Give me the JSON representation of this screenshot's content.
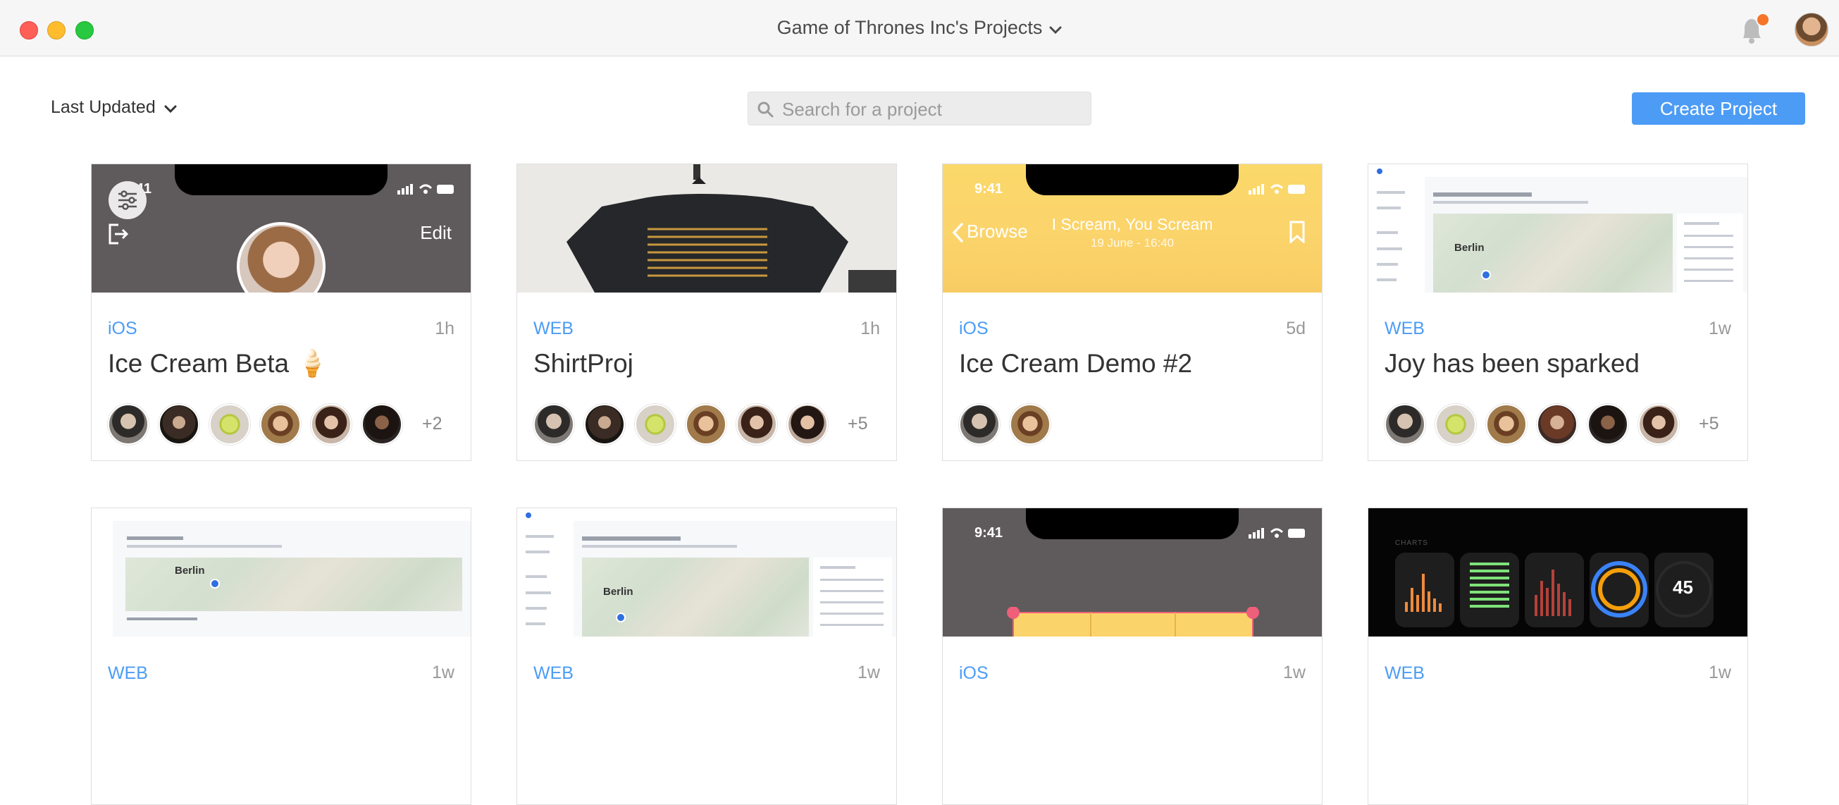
{
  "window": {
    "title": "Game of Thrones Inc's Projects"
  },
  "toolbar": {
    "sort_label": "Last Updated",
    "search_placeholder": "Search for a project",
    "create_label": "Create Project"
  },
  "projects": [
    {
      "platform": "iOS",
      "time": "1h",
      "name": "Ice Cream Beta 🍦",
      "extra": "+2",
      "thumb": {
        "status_time": "9:41",
        "action": "Edit"
      }
    },
    {
      "platform": "WEB",
      "time": "1h",
      "name": "ShirtProj",
      "extra": "+5"
    },
    {
      "platform": "iOS",
      "time": "5d",
      "name": "Ice Cream Demo #2",
      "extra": "",
      "thumb": {
        "status_time": "9:41",
        "back": "Browse",
        "title": "I Scream, You Scream",
        "subtitle": "19 June - 16:40"
      }
    },
    {
      "platform": "WEB",
      "time": "1w",
      "name": "Joy has been sparked",
      "extra": "+5",
      "thumb": {
        "city": "Berlin"
      }
    },
    {
      "platform": "WEB",
      "time": "1w",
      "thumb": {
        "city": "Berlin"
      }
    },
    {
      "platform": "WEB",
      "time": "1w",
      "thumb": {
        "city": "Berlin"
      }
    },
    {
      "platform": "iOS",
      "time": "1w",
      "thumb": {
        "status_time": "9:41"
      }
    },
    {
      "platform": "WEB",
      "time": "1w",
      "thumb": {
        "label": "CHARTS",
        "stat": "45"
      }
    }
  ],
  "colors": {
    "accent": "#4c9cf5",
    "traffic_red": "#fe5f57",
    "traffic_yellow": "#febc2e",
    "traffic_green": "#28c840"
  }
}
